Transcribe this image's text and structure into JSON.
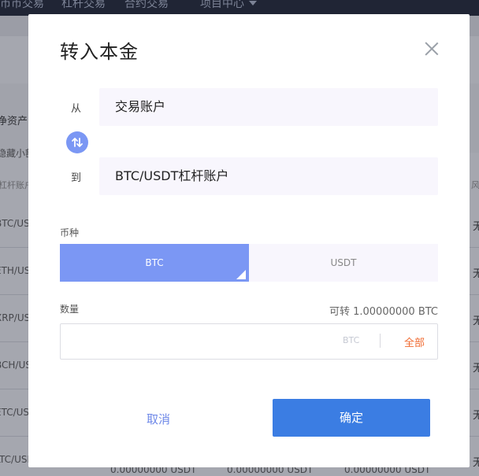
{
  "background": {
    "nav": {
      "items": [
        "币币交易",
        "杠杆交易",
        "合约交易",
        "项目中心"
      ]
    },
    "side_labels": {
      "net_assets": "净资产",
      "hide_small": "隐藏小额",
      "account_header": "杠杆账户",
      "right_header": "风"
    },
    "rows": [
      {
        "pair": "BTC/USD",
        "right": "无"
      },
      {
        "pair": "ETH/USD",
        "right": "无"
      },
      {
        "pair": "XRP/USD",
        "right": "无"
      },
      {
        "pair": "BCH/USD",
        "right": "无"
      },
      {
        "pair": "ETC/USD",
        "right": "无"
      },
      {
        "pair": "LTC/USD",
        "right": "无"
      }
    ],
    "bottom_values": [
      "0.00000000 USDT",
      "0.00000000 USDT",
      "0.00000000 USDT"
    ]
  },
  "modal": {
    "title": "转入本金",
    "from_label": "从",
    "from_account": "交易账户",
    "to_label": "到",
    "to_account": "BTC/USDT杠杆账户",
    "coin_label": "币种",
    "coins": [
      {
        "label": "BTC",
        "selected": true
      },
      {
        "label": "USDT",
        "selected": false
      }
    ],
    "quantity_label": "数量",
    "available": "可转 1.00000000 BTC",
    "quantity_value": "",
    "quantity_unit": "BTC",
    "all_label": "全部",
    "cancel_label": "取消",
    "confirm_label": "确定"
  },
  "colors": {
    "accent": "#7b97f4",
    "primary_button": "#3b7de3",
    "all_link": "#f06b32",
    "input_bg": "#f8f6fd"
  },
  "icons": {
    "close": "close-icon",
    "swap": "swap-arrows-icon",
    "dropdown": "chevron-down-icon"
  }
}
